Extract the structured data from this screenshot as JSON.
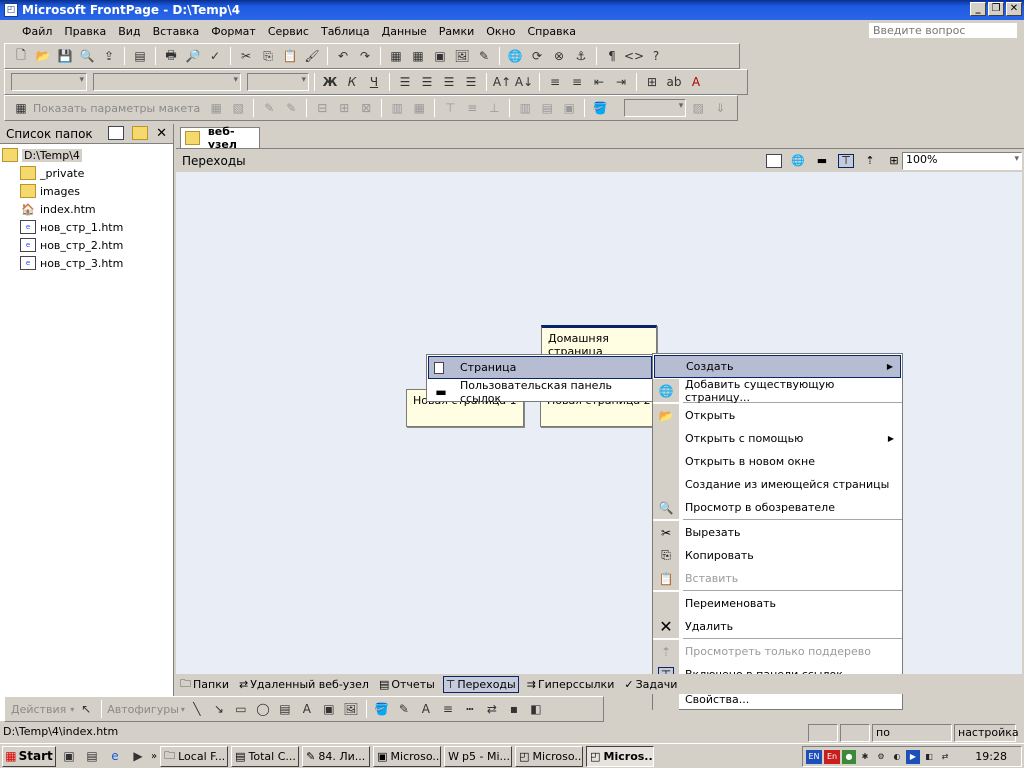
{
  "window": {
    "title": "Microsoft FrontPage - D:\\Temp\\4"
  },
  "menubar": {
    "items": [
      "Файл",
      "Правка",
      "Вид",
      "Вставка",
      "Формат",
      "Сервис",
      "Таблица",
      "Данные",
      "Рамки",
      "Окно",
      "Справка"
    ],
    "ask_placeholder": "Введите вопрос"
  },
  "toolbar3": {
    "layout_label": "Показать параметры макета"
  },
  "folder_panel": {
    "title": "Список папок",
    "root": "D:\\Temp\\4",
    "items": [
      "_private",
      "images",
      "index.htm",
      "нов_стр_1.htm",
      "нов_стр_2.htm",
      "нов_стр_3.htm"
    ]
  },
  "doc_tab": {
    "label": "веб-узел"
  },
  "nav_view": {
    "title": "Переходы",
    "zoom": "100%",
    "home_node": "Домашняя страница",
    "node1": "Новая страница 1",
    "node2": "Новая страница 2"
  },
  "submenu": {
    "items": [
      "Страница",
      "Пользовательская панель ссылок"
    ]
  },
  "context_menu": {
    "items": [
      "Создать",
      "Добавить существующую страницу...",
      "Открыть",
      "Открыть с помощью",
      "Открыть в новом окне",
      "Создание из имеющейся страницы",
      "Просмотр в обозревателе",
      "Вырезать",
      "Копировать",
      "Вставить",
      "Переименовать",
      "Удалить",
      "Просмотреть только поддерево",
      "Включено в панели ссылок",
      "Свойства..."
    ]
  },
  "view_tabs": {
    "items": [
      "Папки",
      "Удаленный веб-узел",
      "Отчеты",
      "Переходы",
      "Гиперссылки",
      "Задачи"
    ]
  },
  "draw_toolbar": {
    "actions": "Действия",
    "autoshapes": "Автофигуры"
  },
  "statusbar": {
    "path": "D:\\Temp\\4\\index.htm",
    "mode": "по умолчанию",
    "custom": "настройка"
  },
  "taskbar": {
    "start": "Start",
    "tasks": [
      "Local F...",
      "Total C...",
      "84. Ли...",
      "Microso...",
      "p5 - Mi...",
      "Microso...",
      "Micros..."
    ],
    "tray_lang1": "EN",
    "tray_lang2": "En",
    "clock": "19:28"
  }
}
